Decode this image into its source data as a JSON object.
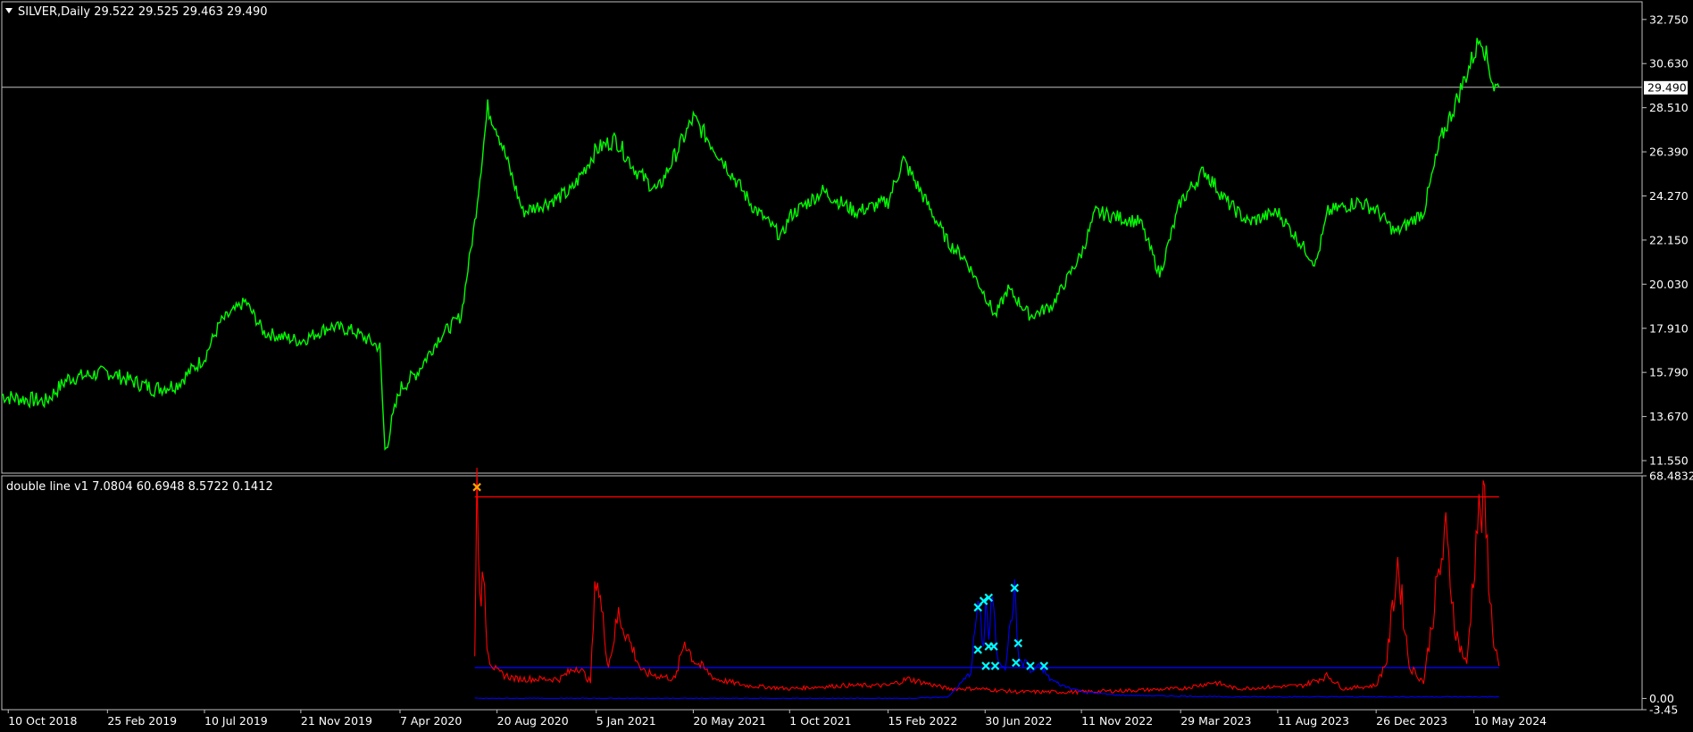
{
  "colors": {
    "background": "#000000",
    "frame": "#c0c0c0",
    "price_line": "#00ff00",
    "current_price_line": "#c0c0c0",
    "osc_red": "#ff0000",
    "osc_blue": "#0000ff",
    "marker_cyan": "#00ffff",
    "marker_orange": "#ffa500"
  },
  "main_header": {
    "icon": "triangle-down-icon",
    "text": "SILVER,Daily  29.522 29.525 29.463 29.490"
  },
  "sub_header": {
    "text": "double line v1 7.0804 60.6948 8.5722 0.1412"
  },
  "current_price": {
    "value": 29.49,
    "label": "29.490"
  },
  "chart_data": [
    {
      "type": "line",
      "name": "price",
      "x_labels": [
        "10 Oct 2018",
        "25 Feb 2019",
        "10 Jul 2019",
        "21 Nov 2019",
        "7 Apr 2020",
        "20 Aug 2020",
        "5 Jan 2021",
        "20 May 2021",
        "1 Oct 2021",
        "15 Feb 2022",
        "30 Jun 2022",
        "11 Nov 2022",
        "29 Mar 2023",
        "11 Aug 2023",
        "26 Dec 2023",
        "10 May 2024"
      ],
      "y_ticks": [
        "32.750",
        "30.630",
        "28.510",
        "26.390",
        "24.270",
        "22.150",
        "20.030",
        "17.910",
        "15.790",
        "13.670",
        "11.550"
      ],
      "ylim": [
        10.95,
        33.6
      ],
      "x": [
        "2018-10-01",
        "2018-10-10",
        "2018-12-01",
        "2019-01-01",
        "2019-02-25",
        "2019-05-01",
        "2019-06-01",
        "2019-07-10",
        "2019-08-01",
        "2019-09-05",
        "2019-10-01",
        "2019-11-21",
        "2020-01-01",
        "2020-02-01",
        "2020-03-10",
        "2020-03-17",
        "2020-04-07",
        "2020-05-01",
        "2020-06-01",
        "2020-07-01",
        "2020-07-20",
        "2020-08-07",
        "2020-08-20",
        "2020-09-25",
        "2020-11-01",
        "2020-12-01",
        "2021-01-05",
        "2021-02-01",
        "2021-03-01",
        "2021-03-31",
        "2021-05-20",
        "2021-06-30",
        "2021-08-10",
        "2021-09-20",
        "2021-10-01",
        "2021-11-16",
        "2022-01-01",
        "2022-02-15",
        "2022-03-08",
        "2022-04-01",
        "2022-05-10",
        "2022-06-01",
        "2022-06-30",
        "2022-07-14",
        "2022-08-01",
        "2022-09-01",
        "2022-10-01",
        "2022-11-11",
        "2022-12-01",
        "2023-02-01",
        "2023-02-28",
        "2023-03-29",
        "2023-05-01",
        "2023-06-01",
        "2023-07-01",
        "2023-08-11",
        "2023-10-03",
        "2023-10-20",
        "2023-12-01",
        "2023-12-26",
        "2024-01-22",
        "2024-03-01",
        "2024-03-25",
        "2024-04-12",
        "2024-05-20",
        "2024-06-07",
        "2024-06-14"
      ],
      "y": [
        14.7,
        14.6,
        14.4,
        15.5,
        15.8,
        15.0,
        15.2,
        16.5,
        18.2,
        19.2,
        17.7,
        17.3,
        18.0,
        17.8,
        17.0,
        12.0,
        15.0,
        15.8,
        17.5,
        18.5,
        23.0,
        28.5,
        27.5,
        23.5,
        24.0,
        24.5,
        26.5,
        27.0,
        25.5,
        24.5,
        28.0,
        26.0,
        23.8,
        22.3,
        23.3,
        24.5,
        23.5,
        24.0,
        26.0,
        24.5,
        22.0,
        21.3,
        19.5,
        18.5,
        19.8,
        18.5,
        19.0,
        21.5,
        23.5,
        23.0,
        20.5,
        24.0,
        25.5,
        24.0,
        23.0,
        23.5,
        21.0,
        23.5,
        24.0,
        23.6,
        22.5,
        23.5,
        27.0,
        28.5,
        32.0,
        29.5,
        29.49
      ]
    },
    {
      "type": "line",
      "name": "oscillator",
      "y_ticks": [
        "68.4832",
        "0.00",
        "-3.45"
      ],
      "ylim": [
        -3.45,
        68.4832
      ],
      "x_labels": [
        "10 Oct 2018",
        "25 Feb 2019",
        "10 Jul 2019",
        "21 Nov 2019",
        "7 Apr 2020",
        "20 Aug 2020",
        "5 Jan 2021",
        "20 May 2021",
        "1 Oct 2021",
        "15 Feb 2022",
        "30 Jun 2022",
        "11 Nov 2022",
        "29 Mar 2023",
        "11 Aug 2023",
        "26 Dec 2023",
        "10 May 2024"
      ],
      "levels": [
        62,
        9.5
      ],
      "level_range": [
        "2020-07-20",
        "2024-06-14"
      ],
      "series": [
        {
          "color": "#ff0000",
          "x": [
            "2020-07-20",
            "2020-07-23",
            "2020-07-29",
            "2020-08-01",
            "2020-08-06",
            "2020-08-10",
            "2020-08-20",
            "2020-09-15",
            "2020-11-15",
            "2020-12-10",
            "2020-12-28",
            "2021-01-05",
            "2021-01-22",
            "2021-02-05",
            "2021-03-10",
            "2021-04-25",
            "2021-05-08",
            "2021-05-20",
            "2021-06-20",
            "2021-08-01",
            "2021-10-01",
            "2021-12-15",
            "2022-02-15",
            "2022-03-15",
            "2022-05-10",
            "2022-06-20",
            "2022-08-15",
            "2022-11-11",
            "2023-03-29",
            "2023-05-15",
            "2023-06-15",
            "2023-09-15",
            "2023-10-20",
            "2023-11-10",
            "2023-12-26",
            "2024-01-10",
            "2024-01-25",
            "2024-02-10",
            "2024-03-01",
            "2024-03-20",
            "2024-04-01",
            "2024-04-15",
            "2024-04-30",
            "2024-05-15",
            "2024-05-25",
            "2024-06-05",
            "2024-06-14"
          ],
          "y": [
            15,
            66,
            25,
            42,
            18,
            12,
            8,
            6,
            6,
            10,
            5,
            40,
            10,
            26,
            8,
            6,
            18,
            12,
            6,
            4,
            3,
            4,
            4,
            6,
            3,
            3,
            2,
            2,
            3,
            5,
            3,
            4,
            7,
            3,
            4,
            12,
            42,
            10,
            5,
            35,
            50,
            20,
            10,
            55,
            58,
            20,
            10
          ]
        },
        {
          "color": "#0000ff",
          "x": [
            "2020-07-20",
            "2021-09-20",
            "2021-11-16",
            "2022-03-15",
            "2022-05-10",
            "2022-06-10",
            "2022-06-20",
            "2022-06-28",
            "2022-07-01",
            "2022-07-05",
            "2022-07-10",
            "2022-07-17",
            "2022-07-28",
            "2022-08-10",
            "2022-08-15",
            "2022-08-20",
            "2022-08-26",
            "2022-09-01",
            "2022-09-15",
            "2022-09-28",
            "2022-10-15",
            "2022-11-15",
            "2023-01-01",
            "2023-06-01",
            "2023-12-01",
            "2024-06-14"
          ],
          "y": [
            0,
            0,
            0,
            0,
            0.5,
            8,
            30,
            15,
            32,
            18,
            32,
            12,
            10,
            33,
            14,
            10,
            12,
            8,
            10,
            6,
            4,
            2,
            1,
            0.5,
            0.5,
            0.5
          ]
        }
      ],
      "markers": [
        {
          "x": "2020-07-23",
          "y": 65,
          "color": "#ffa500"
        },
        {
          "x": "2022-06-20",
          "y": 28,
          "color": "#00ffff"
        },
        {
          "x": "2022-06-28",
          "y": 30,
          "color": "#00ffff"
        },
        {
          "x": "2022-07-05",
          "y": 31,
          "color": "#00ffff"
        },
        {
          "x": "2022-06-20",
          "y": 15,
          "color": "#00ffff"
        },
        {
          "x": "2022-07-05",
          "y": 16,
          "color": "#00ffff"
        },
        {
          "x": "2022-07-12",
          "y": 16,
          "color": "#00ffff"
        },
        {
          "x": "2022-07-01",
          "y": 10,
          "color": "#00ffff"
        },
        {
          "x": "2022-07-14",
          "y": 10,
          "color": "#00ffff"
        },
        {
          "x": "2022-08-10",
          "y": 34,
          "color": "#00ffff"
        },
        {
          "x": "2022-08-15",
          "y": 17,
          "color": "#00ffff"
        },
        {
          "x": "2022-08-12",
          "y": 11,
          "color": "#00ffff"
        },
        {
          "x": "2022-09-01",
          "y": 10,
          "color": "#00ffff"
        },
        {
          "x": "2022-09-20",
          "y": 10,
          "color": "#00ffff"
        }
      ]
    }
  ]
}
